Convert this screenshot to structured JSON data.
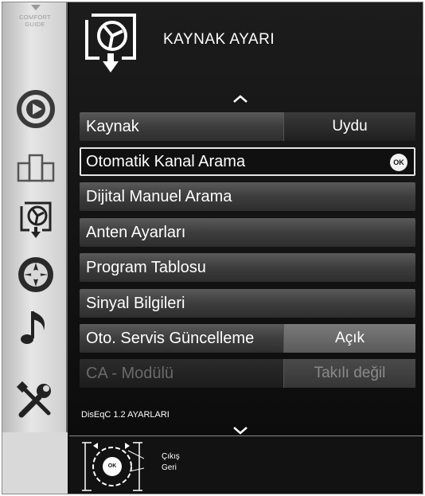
{
  "sidebar": {
    "guide_label_line1": "COMFORT",
    "guide_label_line2": "GUIDE",
    "icons": [
      "playback-icon",
      "sources-icon",
      "source-settings-icon",
      "picture-icon",
      "music-icon",
      "tools-icon"
    ]
  },
  "header": {
    "title": "KAYNAK AYARI",
    "icon": "source-settings-icon"
  },
  "menu": {
    "items": [
      {
        "label": "Kaynak",
        "value": "Uydu"
      },
      {
        "label": "Otomatik Kanal Arama",
        "badge": "OK"
      },
      {
        "label": "Dijital Manuel Arama"
      },
      {
        "label": "Anten Ayarları"
      },
      {
        "label": "Program Tablosu"
      },
      {
        "label": "Sinyal Bilgileri"
      },
      {
        "label": "Oto. Servis Güncelleme",
        "value": "Açık"
      },
      {
        "label": "CA - Modülü",
        "value": "Takılı değil"
      }
    ],
    "footer_note": "DisEqC 1.2 AYARLARI"
  },
  "help": {
    "remote_ok_label": "OK",
    "exit_label": "Çıkış",
    "back_label": "Geri"
  }
}
